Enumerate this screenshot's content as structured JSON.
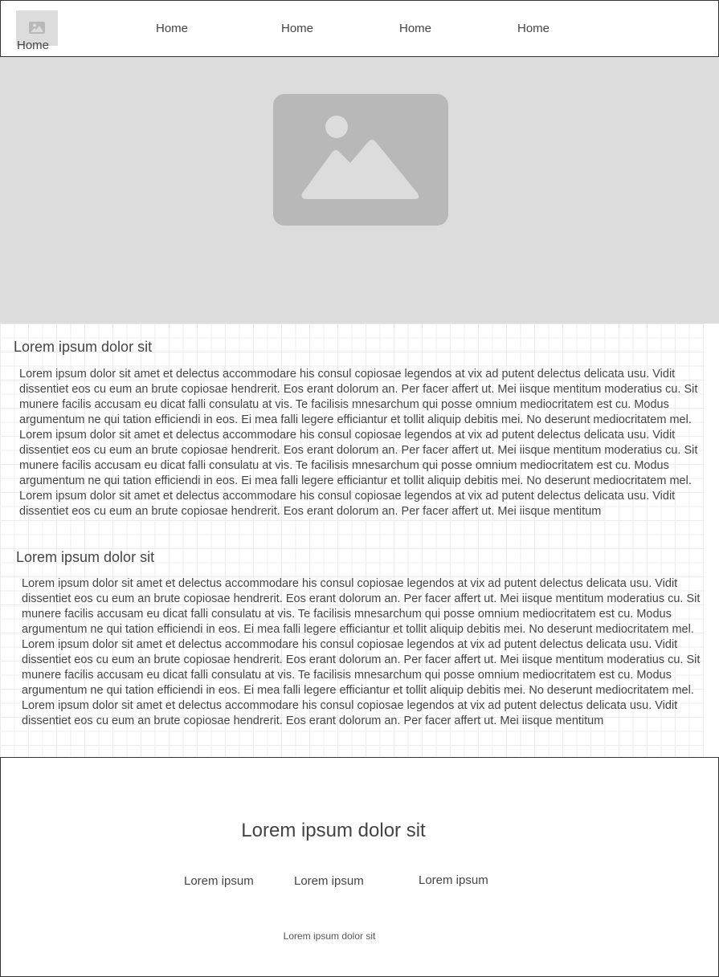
{
  "header": {
    "logo_icon": "image-placeholder-icon",
    "logo_label": "Home",
    "nav": [
      "Home",
      "Home",
      "Home",
      "Home"
    ]
  },
  "hero": {
    "image_icon": "image-placeholder-icon"
  },
  "sections": [
    {
      "title": "Lorem ipsum dolor sit",
      "body": "Lorem ipsum dolor sit amet et delectus accommodare his consul copiosae legendos at vix ad putent delectus delicata usu. Vidit dissentiet eos cu eum an brute copiosae hendrerit. Eos erant dolorum an. Per facer affert ut. Mei iisque mentitum moderatius cu. Sit munere facilis accusam eu dicat falli consulatu at vis. Te facilisis mnesarchum qui posse omnium mediocritatem est cu. Modus argumentum ne qui tation efficiendi in eos. Ei mea falli legere efficiantur et tollit aliquip debitis mei. No deserunt mediocritatem mel. Lorem ipsum dolor sit amet et delectus accommodare his consul copiosae legendos at vix ad putent delectus delicata usu. Vidit dissentiet eos cu eum an brute copiosae hendrerit. Eos erant dolorum an. Per facer affert ut. Mei iisque mentitum moderatius cu. Sit munere facilis accusam eu dicat falli consulatu at vis. Te facilisis mnesarchum qui posse omnium mediocritatem est cu. Modus argumentum ne qui tation efficiendi in eos. Ei mea falli legere efficiantur et tollit aliquip debitis mei. No deserunt mediocritatem mel. Lorem ipsum dolor sit amet et delectus accommodare his consul copiosae legendos at vix ad putent delectus delicata usu. Vidit dissentiet eos cu eum an brute copiosae hendrerit. Eos erant dolorum an. Per facer affert ut. Mei iisque mentitum"
    },
    {
      "title": "Lorem ipsum dolor sit",
      "body": "Lorem ipsum dolor sit amet et delectus accommodare his consul copiosae legendos at vix ad putent delectus delicata usu. Vidit dissentiet eos cu eum an brute copiosae hendrerit. Eos erant dolorum an. Per facer affert ut. Mei iisque mentitum moderatius cu. Sit munere facilis accusam eu dicat falli consulatu at vis. Te facilisis mnesarchum qui posse omnium mediocritatem est cu. Modus argumentum ne qui tation efficiendi in eos. Ei mea falli legere efficiantur et tollit aliquip debitis mei. No deserunt mediocritatem mel. Lorem ipsum dolor sit amet et delectus accommodare his consul copiosae legendos at vix ad putent delectus delicata usu. Vidit dissentiet eos cu eum an brute copiosae hendrerit. Eos erant dolorum an. Per facer affert ut. Mei iisque mentitum moderatius cu. Sit munere facilis accusam eu dicat falli consulatu at vis. Te facilisis mnesarchum qui posse omnium mediocritatem est cu. Modus argumentum ne qui tation efficiendi in eos. Ei mea falli legere efficiantur et tollit aliquip debitis mei. No deserunt mediocritatem mel. Lorem ipsum dolor sit amet et delectus accommodare his consul copiosae legendos at vix ad putent delectus delicata usu. Vidit dissentiet eos cu eum an brute copiosae hendrerit. Eos erant dolorum an. Per facer affert ut. Mei iisque mentitum"
    }
  ],
  "footer": {
    "title": "Lorem ipsum dolor sit",
    "links": [
      "Lorem ipsum",
      "Lorem ipsum",
      "Lorem ipsum"
    ],
    "small_text": "Lorem ipsum dolor sit"
  },
  "colors": {
    "placeholder_bg": "#dcdcdc",
    "placeholder_icon": "#b8b8b8",
    "text": "#444444",
    "border": "#333333",
    "grid": "#ececec"
  }
}
